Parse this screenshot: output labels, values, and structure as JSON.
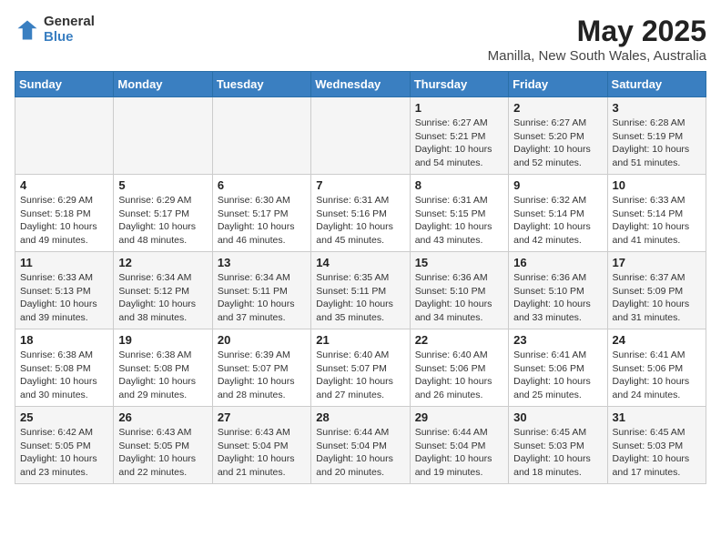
{
  "header": {
    "logo_general": "General",
    "logo_blue": "Blue",
    "main_title": "May 2025",
    "subtitle": "Manilla, New South Wales, Australia"
  },
  "days_of_week": [
    "Sunday",
    "Monday",
    "Tuesday",
    "Wednesday",
    "Thursday",
    "Friday",
    "Saturday"
  ],
  "weeks": [
    [
      {
        "day": "",
        "info": ""
      },
      {
        "day": "",
        "info": ""
      },
      {
        "day": "",
        "info": ""
      },
      {
        "day": "",
        "info": ""
      },
      {
        "day": "1",
        "info": "Sunrise: 6:27 AM\nSunset: 5:21 PM\nDaylight: 10 hours\nand 54 minutes."
      },
      {
        "day": "2",
        "info": "Sunrise: 6:27 AM\nSunset: 5:20 PM\nDaylight: 10 hours\nand 52 minutes."
      },
      {
        "day": "3",
        "info": "Sunrise: 6:28 AM\nSunset: 5:19 PM\nDaylight: 10 hours\nand 51 minutes."
      }
    ],
    [
      {
        "day": "4",
        "info": "Sunrise: 6:29 AM\nSunset: 5:18 PM\nDaylight: 10 hours\nand 49 minutes."
      },
      {
        "day": "5",
        "info": "Sunrise: 6:29 AM\nSunset: 5:17 PM\nDaylight: 10 hours\nand 48 minutes."
      },
      {
        "day": "6",
        "info": "Sunrise: 6:30 AM\nSunset: 5:17 PM\nDaylight: 10 hours\nand 46 minutes."
      },
      {
        "day": "7",
        "info": "Sunrise: 6:31 AM\nSunset: 5:16 PM\nDaylight: 10 hours\nand 45 minutes."
      },
      {
        "day": "8",
        "info": "Sunrise: 6:31 AM\nSunset: 5:15 PM\nDaylight: 10 hours\nand 43 minutes."
      },
      {
        "day": "9",
        "info": "Sunrise: 6:32 AM\nSunset: 5:14 PM\nDaylight: 10 hours\nand 42 minutes."
      },
      {
        "day": "10",
        "info": "Sunrise: 6:33 AM\nSunset: 5:14 PM\nDaylight: 10 hours\nand 41 minutes."
      }
    ],
    [
      {
        "day": "11",
        "info": "Sunrise: 6:33 AM\nSunset: 5:13 PM\nDaylight: 10 hours\nand 39 minutes."
      },
      {
        "day": "12",
        "info": "Sunrise: 6:34 AM\nSunset: 5:12 PM\nDaylight: 10 hours\nand 38 minutes."
      },
      {
        "day": "13",
        "info": "Sunrise: 6:34 AM\nSunset: 5:11 PM\nDaylight: 10 hours\nand 37 minutes."
      },
      {
        "day": "14",
        "info": "Sunrise: 6:35 AM\nSunset: 5:11 PM\nDaylight: 10 hours\nand 35 minutes."
      },
      {
        "day": "15",
        "info": "Sunrise: 6:36 AM\nSunset: 5:10 PM\nDaylight: 10 hours\nand 34 minutes."
      },
      {
        "day": "16",
        "info": "Sunrise: 6:36 AM\nSunset: 5:10 PM\nDaylight: 10 hours\nand 33 minutes."
      },
      {
        "day": "17",
        "info": "Sunrise: 6:37 AM\nSunset: 5:09 PM\nDaylight: 10 hours\nand 31 minutes."
      }
    ],
    [
      {
        "day": "18",
        "info": "Sunrise: 6:38 AM\nSunset: 5:08 PM\nDaylight: 10 hours\nand 30 minutes."
      },
      {
        "day": "19",
        "info": "Sunrise: 6:38 AM\nSunset: 5:08 PM\nDaylight: 10 hours\nand 29 minutes."
      },
      {
        "day": "20",
        "info": "Sunrise: 6:39 AM\nSunset: 5:07 PM\nDaylight: 10 hours\nand 28 minutes."
      },
      {
        "day": "21",
        "info": "Sunrise: 6:40 AM\nSunset: 5:07 PM\nDaylight: 10 hours\nand 27 minutes."
      },
      {
        "day": "22",
        "info": "Sunrise: 6:40 AM\nSunset: 5:06 PM\nDaylight: 10 hours\nand 26 minutes."
      },
      {
        "day": "23",
        "info": "Sunrise: 6:41 AM\nSunset: 5:06 PM\nDaylight: 10 hours\nand 25 minutes."
      },
      {
        "day": "24",
        "info": "Sunrise: 6:41 AM\nSunset: 5:06 PM\nDaylight: 10 hours\nand 24 minutes."
      }
    ],
    [
      {
        "day": "25",
        "info": "Sunrise: 6:42 AM\nSunset: 5:05 PM\nDaylight: 10 hours\nand 23 minutes."
      },
      {
        "day": "26",
        "info": "Sunrise: 6:43 AM\nSunset: 5:05 PM\nDaylight: 10 hours\nand 22 minutes."
      },
      {
        "day": "27",
        "info": "Sunrise: 6:43 AM\nSunset: 5:04 PM\nDaylight: 10 hours\nand 21 minutes."
      },
      {
        "day": "28",
        "info": "Sunrise: 6:44 AM\nSunset: 5:04 PM\nDaylight: 10 hours\nand 20 minutes."
      },
      {
        "day": "29",
        "info": "Sunrise: 6:44 AM\nSunset: 5:04 PM\nDaylight: 10 hours\nand 19 minutes."
      },
      {
        "day": "30",
        "info": "Sunrise: 6:45 AM\nSunset: 5:03 PM\nDaylight: 10 hours\nand 18 minutes."
      },
      {
        "day": "31",
        "info": "Sunrise: 6:45 AM\nSunset: 5:03 PM\nDaylight: 10 hours\nand 17 minutes."
      }
    ]
  ]
}
